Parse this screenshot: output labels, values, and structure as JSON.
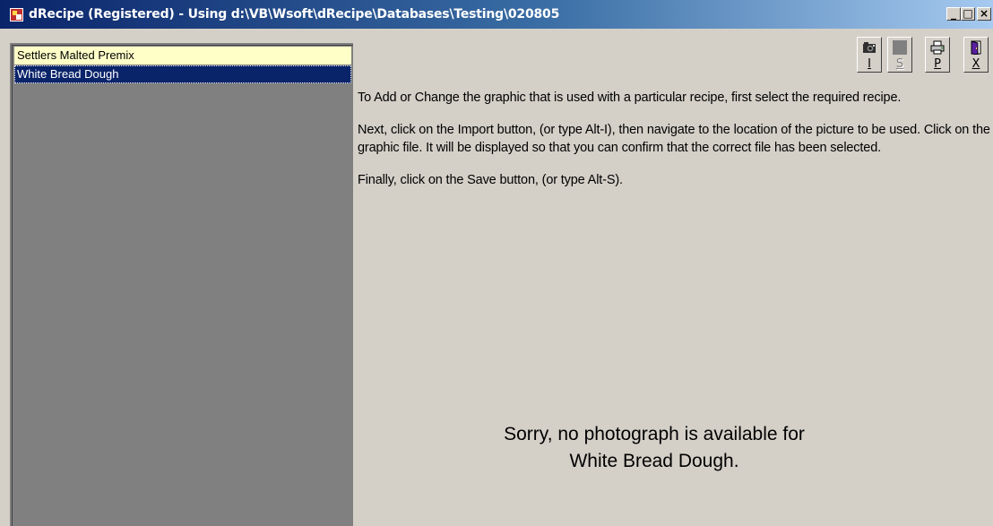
{
  "window": {
    "title": "dRecipe (Registered) - Using d:\\VB\\Wsoft\\dRecipe\\Databases\\Testing\\020805",
    "caption_buttons": {
      "minimize": "_",
      "maximize": "□",
      "close": "×"
    }
  },
  "recipe_list": {
    "items": [
      {
        "label": "Settlers Malted Premix",
        "selected": false
      },
      {
        "label": "White Bread Dough",
        "selected": true
      }
    ]
  },
  "toolbar": {
    "buttons": [
      {
        "key": "I",
        "icon": "camera-icon",
        "action": "Import",
        "enabled": true
      },
      {
        "key": "S",
        "icon": "save-icon",
        "action": "Save",
        "enabled": false
      },
      {
        "key": "P",
        "icon": "printer-icon",
        "action": "Print",
        "enabled": true
      },
      {
        "key": "X",
        "icon": "exit-door-icon",
        "action": "Exit",
        "enabled": true
      }
    ]
  },
  "instructions": {
    "paragraph_1": "To Add or Change the graphic that is used with a particular recipe, first select the required recipe.",
    "paragraph_2": "Next, click on the Import button, (or type Alt-I), then navigate to the location of the picture to be used.  Click on the graphic file. It will be displayed so that you can confirm that the correct file has been selected.",
    "paragraph_3": "Finally, click on the Save button, (or type Alt-S)."
  },
  "photo_area": {
    "message": "Sorry, no photograph is available for White Bread Dough."
  },
  "colors": {
    "title_start": "#0a246a",
    "title_end": "#a6caf0",
    "selected_item": "#0a246a",
    "highlight_item": "#ffffc8",
    "face": "#d4d0c8",
    "list_background": "#808080"
  }
}
